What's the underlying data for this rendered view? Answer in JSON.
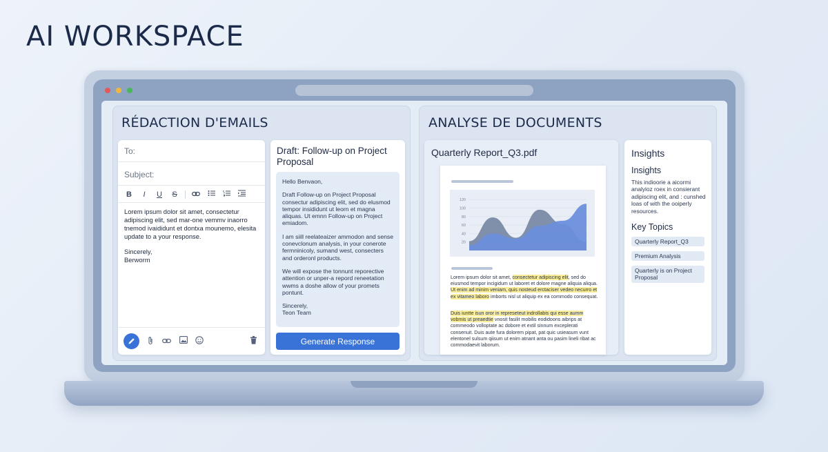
{
  "headline": "AI WORKSPACE",
  "email_panel": {
    "title": "RÉDACTION D'EMAILS",
    "to_label": "To:",
    "subject_label": "Subject:",
    "toolbar": [
      "B",
      "I",
      "U",
      "S"
    ],
    "body_paragraph": "Lorem ipsum dolor sit amet, consectetur adipiscing elit, sed mar-one vemmv inaorro tnemod ivaididunt et dontxa mounemo, elesita update to a your response.",
    "signoff": "Sincerely,",
    "signature": "Berworm"
  },
  "draft": {
    "title": "Draft: Follow-up on Project Proposal",
    "greeting": "Hello Benvaon,",
    "para1": "Draft Follow-up on Project Proposal consectur adipiscing elit, sed do elusmod tempor insididunt ut leorn et magna aliquas. Ut emnn Follow-up on Project emiadom.",
    "para2": "I am siill reelateaizer ammodon and sense conevclonum analysis, in your conerote fermninicoly, sumand west, consecters and orderonl products.",
    "para3": "We will expose the tonnunt reporective attention or unper-a repord reneetation wwms a doshe allow of your promets pontunt.",
    "signoff": "Sincerely,",
    "signature": "Teon Team",
    "button": "Generate Response"
  },
  "doc_panel": {
    "title": "ANALYSE DE DOCUMENTS",
    "file_name": "Quarterly Report_Q3.pdf",
    "text1_a": "Lorem ipsum dolor sit amet, ",
    "text1_hl1": "consectetur adipiscing elit",
    "text1_b": ", sed do eiusmod tempor incigidum ut laboret et dolore magne aliquia aliqua. ",
    "text1_hl2": "Ut enim ad minim veniam, quis nosteud erctaciser vedeo necurro et ex vitameo laboro",
    "text1_c": " imborts nisl ut aliquip ex ea commodo consequat.",
    "text2_hl": "Duis iuntte isun oror in represeteut indrollabis qui esse aumm vobmis ut preaedtie",
    "text2_b": " vnosit fasilit mobilis eodidoons aibrips at commeodo volloptate ac dobore et extil sinnum exceplerati consenuit. Duis aute fura dolorem pipat, pat quic usieasum vunt elentonel sulsum qiisum ut enim atnant anta ou pasim lineli ribat ac commodaevit laborum."
  },
  "chart_data": {
    "type": "area",
    "title": "",
    "y_ticks": [
      120,
      100,
      80,
      60,
      40,
      20
    ],
    "ylim": [
      0,
      130
    ],
    "series": [
      {
        "values": [
          22,
          78,
          30,
          96,
          62,
          20
        ],
        "color": "#6d7f9e"
      },
      {
        "values": [
          12,
          40,
          28,
          58,
          70,
          110
        ],
        "color": "#6b8fdc"
      }
    ],
    "colors": {
      "background_series": "#8d9cb6",
      "foreground_series": "#6b8fdc"
    }
  },
  "insights": {
    "heading": "Insights",
    "subheading": "Insights",
    "text": "This indioorie a aicormi analyioz roex in consierant adipiscing elit, and : cunshed loas of with the ooiperly resources.",
    "key_topics_label": "Key Topics",
    "topics": [
      "Quarterly Report_Q3",
      "Premium Analysis",
      "Quarterly is on Project Proposal"
    ]
  },
  "colors": {
    "accent": "#3a73d8",
    "highlight": "#fbee9a"
  }
}
